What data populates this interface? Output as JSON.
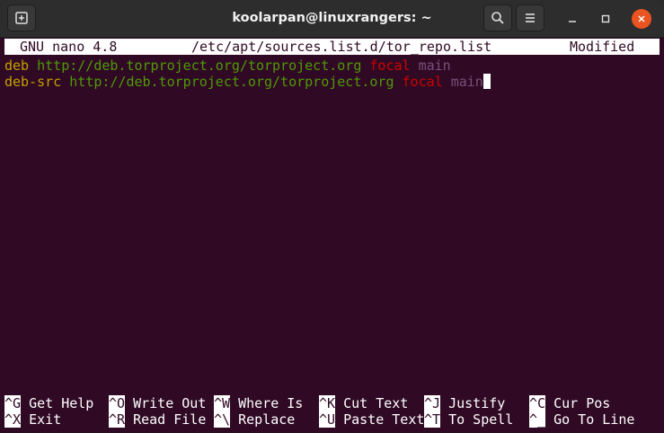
{
  "window": {
    "title": "koolarpan@linuxrangers: ~"
  },
  "icons": {
    "new_tab": "new-tab-icon",
    "search": "search-icon",
    "menu": "hamburger-menu-icon",
    "minimize": "minimize-icon",
    "maximize": "maximize-icon",
    "close": "close-icon"
  },
  "colors": {
    "terminal_bg": "#300a24",
    "keyword": "#c4a000",
    "url": "#4e9a06",
    "distribution": "#cc0000",
    "component": "#75507b",
    "close_button": "#e95420"
  },
  "nano": {
    "version": "GNU nano 4.8",
    "filename": "/etc/apt/sources.list.d/tor_repo.list",
    "status": "Modified"
  },
  "file_lines": [
    {
      "type": "deb",
      "url": "http://deb.torproject.org/torproject.org",
      "dist": "focal",
      "component": "main"
    },
    {
      "type": "deb-src",
      "url": "http://deb.torproject.org/torproject.org",
      "dist": "focal",
      "component": "main"
    }
  ],
  "shortcuts": [
    {
      "key": "^G",
      "label": "Get Help"
    },
    {
      "key": "^O",
      "label": "Write Out"
    },
    {
      "key": "^W",
      "label": "Where Is"
    },
    {
      "key": "^K",
      "label": "Cut Text"
    },
    {
      "key": "^J",
      "label": "Justify"
    },
    {
      "key": "^C",
      "label": "Cur Pos"
    },
    {
      "key": "^X",
      "label": "Exit"
    },
    {
      "key": "^R",
      "label": "Read File"
    },
    {
      "key": "^\\",
      "label": "Replace"
    },
    {
      "key": "^U",
      "label": "Paste Text"
    },
    {
      "key": "^T",
      "label": "To Spell"
    },
    {
      "key": "^_",
      "label": "Go To Line"
    }
  ]
}
